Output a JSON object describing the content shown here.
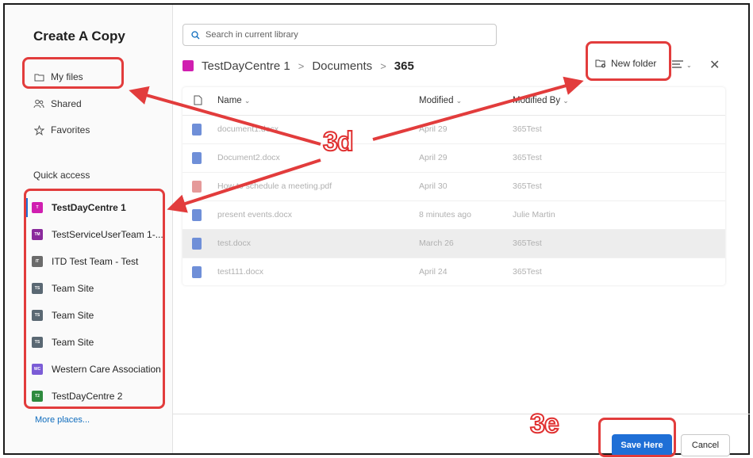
{
  "dialog": {
    "title": "Create A Copy"
  },
  "sidebar": {
    "nav": [
      {
        "label": "My files",
        "icon": "folder-icon"
      },
      {
        "label": "Shared",
        "icon": "people-icon"
      },
      {
        "label": "Favorites",
        "icon": "star-icon"
      }
    ],
    "quick_access_label": "Quick access",
    "sites": [
      {
        "label": "TestDayCentre 1",
        "badge": "T",
        "color": "#d01fb0",
        "selected": true
      },
      {
        "label": "TestServiceUserTeam 1-...",
        "badge": "TM",
        "color": "#8a2a9c"
      },
      {
        "label": "ITD Test Team - Test",
        "badge": "IT",
        "color": "#6b6b6b"
      },
      {
        "label": "Team Site",
        "badge": "TS",
        "color": "#5a6873"
      },
      {
        "label": "Team Site",
        "badge": "TS",
        "color": "#5a6873"
      },
      {
        "label": "Team Site",
        "badge": "TS",
        "color": "#5a6873"
      },
      {
        "label": "Western Care Association",
        "badge": "WC",
        "color": "#7b5cd6"
      },
      {
        "label": "TestDayCentre 2",
        "badge": "T2",
        "color": "#2e8a3e"
      }
    ],
    "more_places": "More places..."
  },
  "search": {
    "placeholder": "Search in current library"
  },
  "breadcrumb": {
    "site": "TestDayCentre 1",
    "library": "Documents",
    "current": "365",
    "separator": ">"
  },
  "toolbar": {
    "new_folder": "New folder",
    "view_icon": "view-options-icon",
    "close_icon": "close-icon"
  },
  "table": {
    "columns": {
      "name": "Name",
      "modified": "Modified",
      "modified_by": "Modified By"
    },
    "rows": [
      {
        "name": "document1.docx",
        "modified": "April 29",
        "by": "365Test",
        "type": "word"
      },
      {
        "name": "Document2.docx",
        "modified": "April 29",
        "by": "365Test",
        "type": "word"
      },
      {
        "name": "How to schedule a meeting.pdf",
        "modified": "April 30",
        "by": "365Test",
        "type": "pdf"
      },
      {
        "name": "present events.docx",
        "modified": "8 minutes ago",
        "by": "Julie Martin",
        "type": "word"
      },
      {
        "name": "test.docx",
        "modified": "March 26",
        "by": "365Test",
        "type": "word",
        "highlighted": true
      },
      {
        "name": "test111.docx",
        "modified": "April 24",
        "by": "365Test",
        "type": "word"
      }
    ]
  },
  "buttons": {
    "save": "Save Here",
    "cancel": "Cancel"
  },
  "annotations": {
    "step_1": "3d",
    "step_2": "3e",
    "color": "#e23c3c"
  },
  "colors": {
    "accent": "#1f6fd6",
    "link": "#0f6cbd"
  }
}
